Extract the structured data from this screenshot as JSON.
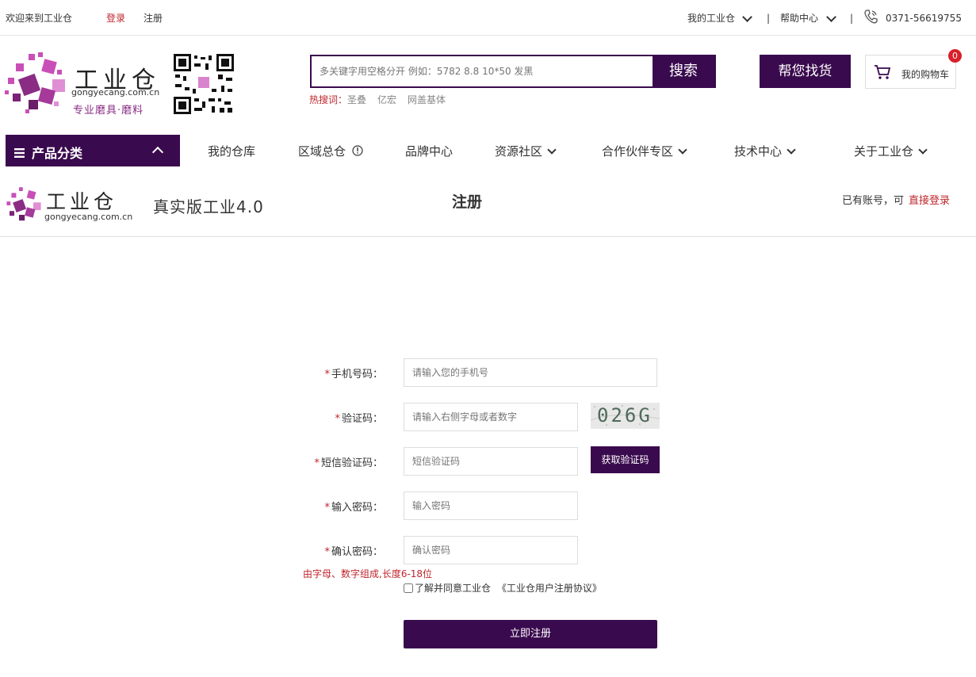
{
  "topbar": {
    "welcome": "欢迎来到工业仓",
    "login": "登录",
    "register": "注册",
    "my_account": "我的工业仓",
    "help_center": "帮助中心",
    "separator": "|",
    "phone": "0371-56619755"
  },
  "header": {
    "brand_name": "工业仓",
    "brand_domain": "gongyecang.com.cn",
    "brand_tagline": "专业磨具·磨料",
    "search_placeholder": "多关键字用空格分开 例如：5782 8.8 10*50 发黑",
    "search_button": "搜索",
    "hot_label": "热搜词：",
    "hot_words": [
      "圣叠",
      "亿宏",
      "网盖基体"
    ],
    "help_find_button": "帮您找货",
    "cart_label": "我的购物车",
    "cart_count": "0"
  },
  "nav": {
    "category_button": "产品分类",
    "items": [
      {
        "label": "我的仓库"
      },
      {
        "label": "区域总仓"
      },
      {
        "label": "品牌中心"
      },
      {
        "label": "资源社区"
      },
      {
        "label": "合作伙伴专区"
      },
      {
        "label": "技术中心"
      },
      {
        "label": "关于工业仓"
      }
    ]
  },
  "register_header": {
    "brand_name": "工业仓",
    "brand_domain": "gongyecang.com.cn",
    "slogan": "真实版工业4.0",
    "title": "注册",
    "has_account": "已有账号，可",
    "login_link": "直接登录"
  },
  "form": {
    "phone_label": "手机号码：",
    "phone_placeholder": "请输入您的手机号",
    "captcha_label": "验证码：",
    "captcha_placeholder": "请输入右侧字母或者数字",
    "captcha_text": "026G",
    "sms_label": "短信验证码：",
    "sms_placeholder": "短信验证码",
    "sms_button": "获取验证码",
    "password_label": "输入密码：",
    "password_placeholder": "输入密码",
    "confirm_label": "确认密码：",
    "confirm_placeholder": "确认密码",
    "required_mark": "*",
    "password_hint": "由字母、数字组成,长度6-18位",
    "agree_text": "了解并同意工业仓",
    "agreement_link": "《工业仓用户注册协议》",
    "submit_button": "立即注册"
  },
  "colors": {
    "brand_purple": "#3a0a4e",
    "accent_red": "#c0252b",
    "logo_magenta": "#c94fb8"
  }
}
